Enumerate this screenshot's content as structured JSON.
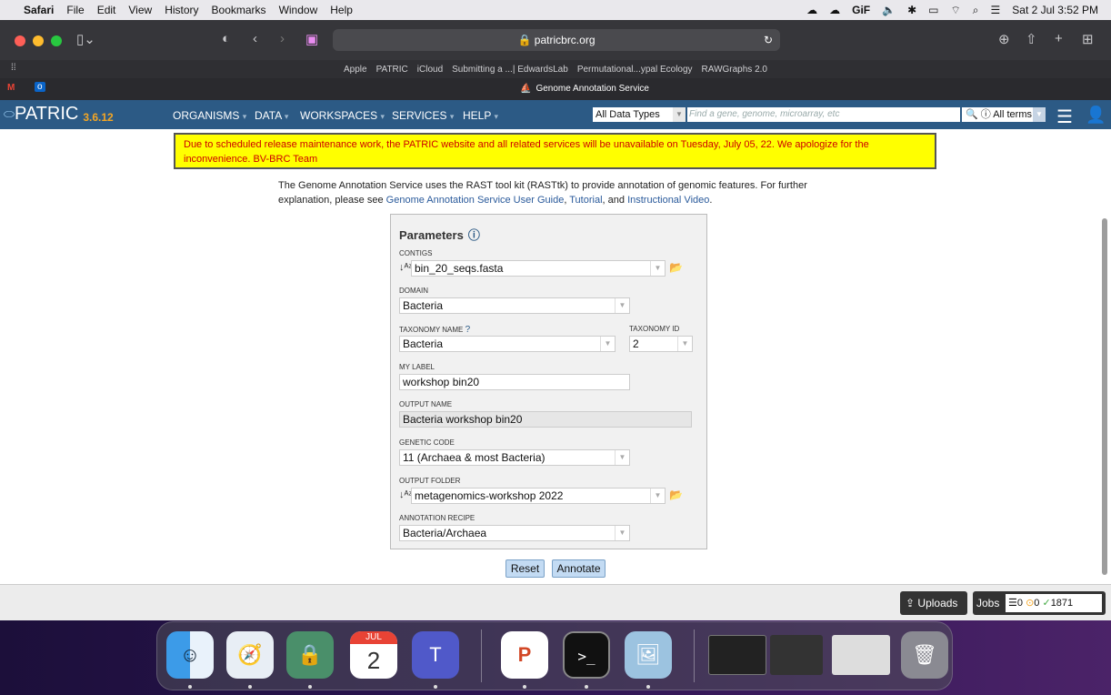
{
  "menubar": {
    "app": "Safari",
    "items": [
      "File",
      "Edit",
      "View",
      "History",
      "Bookmarks",
      "Window",
      "Help"
    ],
    "right_gif": "GiF",
    "clock": "Sat 2 Jul  3:52 PM"
  },
  "browser": {
    "url": "patricbrc.org",
    "favorites": [
      "Apple",
      "PATRIC",
      "iCloud",
      "Submitting a ...| EdwardsLab",
      "Permutational...ypal Ecology",
      "RAWGraphs 2.0"
    ],
    "tab_title": "Genome Annotation Service"
  },
  "patric": {
    "logo": "PATRIC",
    "version": "3.6.12",
    "menu": [
      "ORGANISMS",
      "DATA",
      "WORKSPACES",
      "SERVICES",
      "HELP"
    ],
    "data_type": "All Data Types",
    "search_placeholder": "Find a gene, genome, microarray, etc",
    "all_terms": "All terms"
  },
  "notice": "Due to scheduled release maintenance work, the PATRIC website and all related services will be unavailable on Tuesday, July 05, 22. We apologize for the inconvenience. BV-BRC Team",
  "intro": {
    "text1": "The Genome Annotation Service uses the RAST tool kit (RASTtk) to provide annotation of genomic features. For further explanation, please see ",
    "link1": "Genome Annotation Service User Guide",
    "sep1": ", ",
    "link2": "Tutorial",
    "sep2": ", and ",
    "link3": "Instructional Video",
    "end": "."
  },
  "params": {
    "title": "Parameters",
    "contigs_label": "CONTIGS",
    "contigs_value": "bin_20_seqs.fasta",
    "domain_label": "DOMAIN",
    "domain_value": "Bacteria",
    "taxonomy_name_label": "TAXONOMY NAME",
    "taxonomy_name_value": "Bacteria",
    "taxonomy_id_label": "TAXONOMY ID",
    "taxonomy_id_value": "2",
    "my_label_label": "MY LABEL",
    "my_label_value": "workshop bin20",
    "output_name_label": "OUTPUT NAME",
    "output_name_value": "Bacteria workshop bin20",
    "genetic_code_label": "GENETIC CODE",
    "genetic_code_value": "11 (Archaea & most Bacteria)",
    "output_folder_label": "OUTPUT FOLDER",
    "output_folder_value": "metagenomics-workshop 2022",
    "recipe_label": "ANNOTATION RECIPE",
    "recipe_value": "Bacteria/Archaea"
  },
  "buttons": {
    "reset": "Reset",
    "annotate": "Annotate"
  },
  "status": {
    "uploads": "Uploads",
    "jobs": "Jobs",
    "queued": "0",
    "running": "0",
    "completed": "1871"
  },
  "dock": {
    "calendar_month": "JUL",
    "calendar_day": "2"
  }
}
